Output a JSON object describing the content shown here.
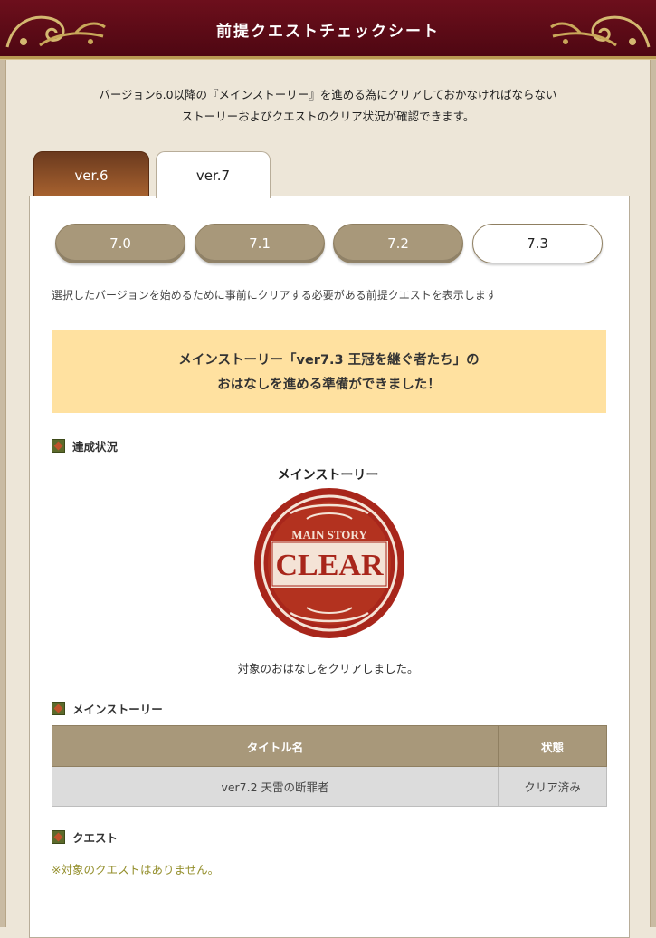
{
  "header": {
    "title": "前提クエストチェックシート"
  },
  "intro": {
    "line1": "バージョン6.0以降の『メインストーリー』を進める為にクリアしておかなければならない",
    "line2": "ストーリーおよびクエストのクリア状況が確認できます。"
  },
  "tabs": [
    {
      "label": "ver.6",
      "active": false
    },
    {
      "label": "ver.7",
      "active": true
    }
  ],
  "versions": [
    {
      "label": "7.0",
      "active": false
    },
    {
      "label": "7.1",
      "active": false
    },
    {
      "label": "7.2",
      "active": false
    },
    {
      "label": "7.3",
      "active": true
    }
  ],
  "description": "選択したバージョンを始めるために事前にクリアする必要がある前提クエストを表示します",
  "notice": {
    "line1": "メインストーリー「ver7.3 王冠を継ぐ者たち」の",
    "line2": "おはなしを進める準備ができました！"
  },
  "progress": {
    "heading": "達成状況",
    "label": "メインストーリー",
    "stamp": {
      "top": "MAIN STORY",
      "main": "CLEAR"
    },
    "message": "対象のおはなしをクリアしました。"
  },
  "main_story": {
    "heading": "メインストーリー",
    "columns": [
      "タイトル名",
      "状態"
    ],
    "rows": [
      {
        "title": "ver7.2 天雷の断罪者",
        "status": "クリア済み"
      }
    ]
  },
  "quest": {
    "heading": "クエスト",
    "note": "※対象のクエストはありません。"
  },
  "colors": {
    "header_bg": "#5e0b17",
    "tab_brown": "#8a4a25",
    "button_tan": "#a8987a",
    "notice_bg": "#ffe1a0",
    "stamp_red": "#a8261b",
    "note_olive": "#948f2c"
  }
}
